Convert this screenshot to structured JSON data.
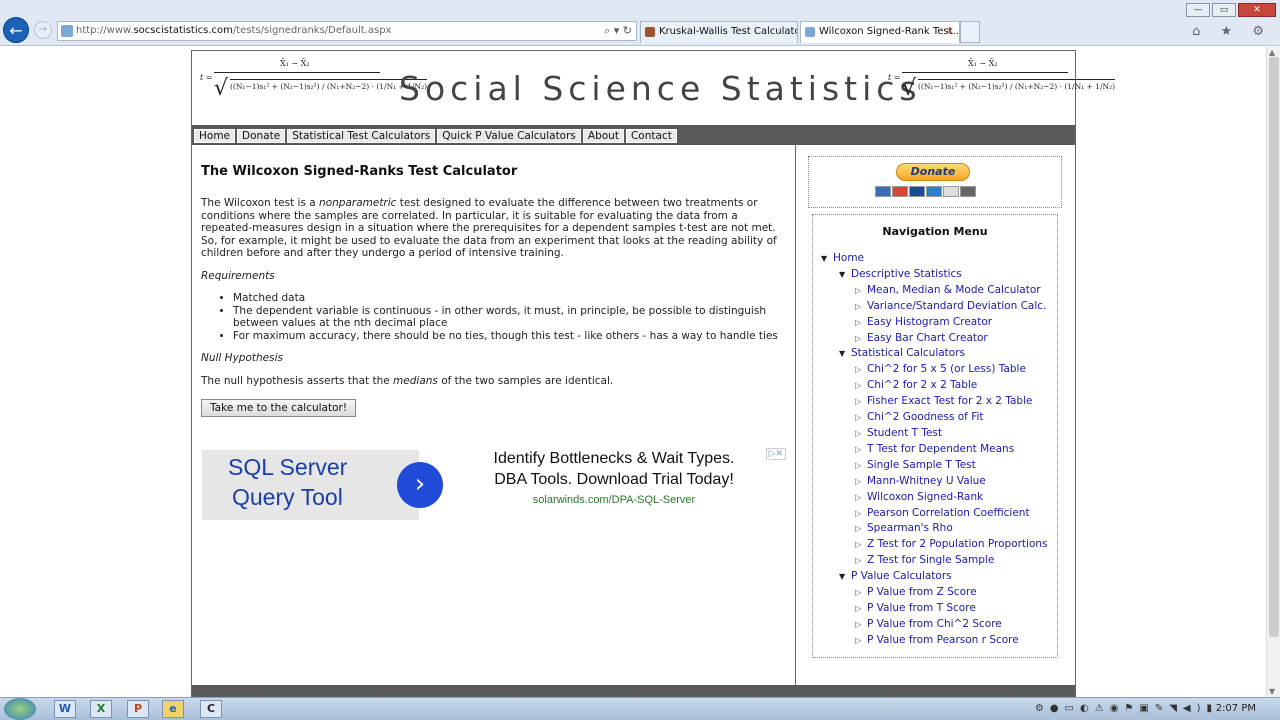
{
  "browser": {
    "url_prefix": "http://www.",
    "url_host": "socscistatistics.com",
    "url_path": "/tests/signedranks/Default.aspx",
    "tabs": [
      {
        "label": "Kruskal-Wallis Test Calculator,..."
      },
      {
        "label": "Wilcoxon Signed-Rank Test..."
      }
    ],
    "tab_close": "×",
    "back_icon": "arrow-left-icon",
    "window_buttons": {
      "minimize": "—",
      "restore": "▭",
      "close": "✕"
    },
    "right_tools": "⌂ ★ ⚙"
  },
  "site": {
    "title": "Social Science Statistics",
    "formula": {
      "lhs": "t =",
      "numerator": "X̄₁ − X̄₂",
      "denominator": "((N₁−1)s₁² + (N₂−1)s₂²) / (N₁+N₂−2) · (1/N₁ + 1/N₂)"
    },
    "nav": [
      "Home",
      "Donate",
      "Statistical Test Calculators",
      "Quick P Value Calculators",
      "About",
      "Contact"
    ]
  },
  "main": {
    "heading": "The Wilcoxon Signed-Ranks Test Calculator",
    "intro_before": "The Wilcoxon test is a ",
    "intro_em": "nonparametric",
    "intro_after": " test designed to evaluate the difference between two treatments or conditions where the samples are correlated. In particular, it is suitable for evaluating the data from a repeated-measures design in a situation where the prerequisites for a dependent samples t-test are not met. So, for example, it might be used to evaluate the data from an experiment that looks at the reading ability of children before and after they undergo a period of intensive training.",
    "requirements_label": "Requirements",
    "requirements": [
      "Matched data",
      "The dependent variable is continuous - in other words, it must, in principle, be possible to distinguish between values at the nth decimal place",
      "For maximum accuracy, there should be no ties, though this test - like others - has a way to handle ties"
    ],
    "null_label": "Null Hypothesis",
    "null_before": "The null hypothesis asserts that the ",
    "null_em": "medians",
    "null_after": " of the two samples are identical.",
    "button": "Take me to the calculator!"
  },
  "ad": {
    "left_line1": "SQL Server",
    "left_line2": "Query Tool",
    "arrow": "›",
    "right_line1": "Identify Bottlenecks & Wait Types.",
    "right_line2": "DBA Tools. Download Trial Today!",
    "url": "solarwinds.com/DPA-SQL-Server",
    "badge": "▷✕"
  },
  "sidebar": {
    "donate": "Donate",
    "nav_title": "Navigation Menu",
    "menu": [
      {
        "level": 0,
        "label": "Home",
        "open": true
      },
      {
        "level": 1,
        "label": "Descriptive Statistics",
        "open": true
      },
      {
        "level": 2,
        "label": "Mean, Median & Mode Calculator"
      },
      {
        "level": 2,
        "label": "Variance/Standard Deviation Calc."
      },
      {
        "level": 2,
        "label": "Easy Histogram Creator"
      },
      {
        "level": 2,
        "label": "Easy Bar Chart Creator"
      },
      {
        "level": 1,
        "label": "Statistical Calculators",
        "open": true
      },
      {
        "level": 2,
        "label": "Chi^2 for 5 x 5 (or Less) Table"
      },
      {
        "level": 2,
        "label": "Chi^2 for 2 x 2 Table"
      },
      {
        "level": 2,
        "label": "Fisher Exact Test for 2 x 2 Table"
      },
      {
        "level": 2,
        "label": "Chi^2 Goodness of Fit"
      },
      {
        "level": 2,
        "label": "Student T Test"
      },
      {
        "level": 2,
        "label": "T Test for Dependent Means"
      },
      {
        "level": 2,
        "label": "Single Sample T Test"
      },
      {
        "level": 2,
        "label": "Mann-Whitney U Value"
      },
      {
        "level": 2,
        "label": "Wilcoxon Signed-Rank"
      },
      {
        "level": 2,
        "label": "Pearson Correlation Coefficient"
      },
      {
        "level": 2,
        "label": "Spearman's Rho"
      },
      {
        "level": 2,
        "label": "Z Test for 2 Population Proportions"
      },
      {
        "level": 2,
        "label": "Z Test for Single Sample"
      },
      {
        "level": 1,
        "label": "P Value Calculators",
        "open": true
      },
      {
        "level": 2,
        "label": "P Value from Z Score"
      },
      {
        "level": 2,
        "label": "P Value from T Score"
      },
      {
        "level": 2,
        "label": "P Value from Chi^2 Score"
      },
      {
        "level": 2,
        "label": "P Value from Pearson r Score"
      }
    ]
  },
  "taskbar": {
    "apps": [
      "W",
      "X",
      "P",
      "e",
      "C"
    ],
    "clock": "2:07 PM"
  },
  "colors": {
    "link": "#1a1ab8",
    "nav_bar": "#5a5a5a",
    "ad_blue": "#1a3fa8"
  }
}
